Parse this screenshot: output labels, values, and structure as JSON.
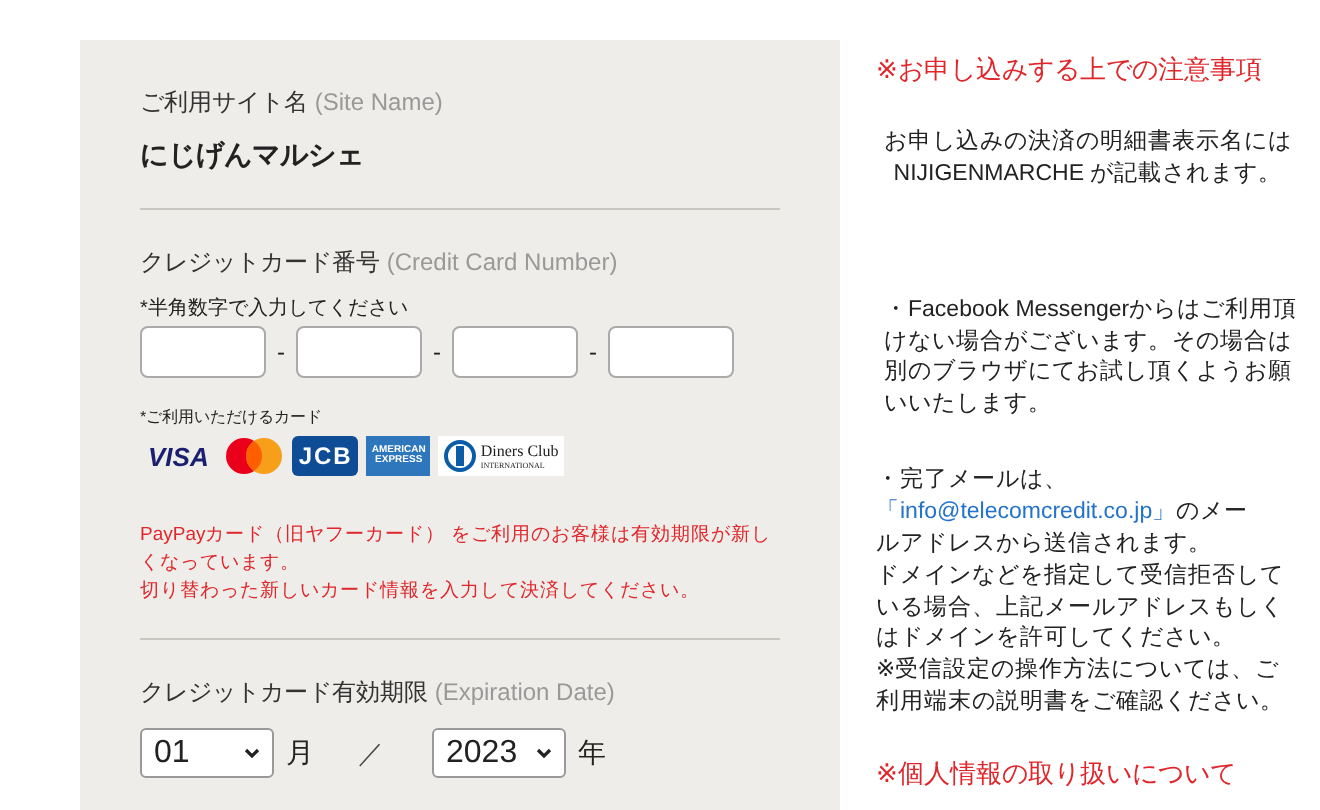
{
  "form": {
    "site_name": {
      "label": "ご利用サイト名",
      "label_en": "(Site Name)",
      "value": "にじげんマルシェ"
    },
    "card_number": {
      "label": "クレジットカード番号",
      "label_en": "(Credit Card Number)",
      "hint": "*半角数字で入力してください",
      "separator": "-"
    },
    "accepted_cards": {
      "label": "*ご利用いただけるカード",
      "cards": [
        {
          "kind": "visa",
          "text": "VISA"
        },
        {
          "kind": "mastercard"
        },
        {
          "kind": "jcb",
          "text": "JCB"
        },
        {
          "kind": "amex",
          "text": "AMERICAN EXPRESS"
        },
        {
          "kind": "diners",
          "text": "Diners Club",
          "subtext": "INTERNATIONAL"
        }
      ]
    },
    "notice": [
      "PayPayカード（旧ヤフーカード） をご利用のお客様は有効期限が新しくなっています。",
      "切り替わった新しいカード情報を入力して決済してください。"
    ],
    "expiration": {
      "label": "クレジットカード有効期限",
      "label_en": "(Expiration Date)",
      "month": "01",
      "month_unit": "月",
      "slash": "／",
      "year": "2023",
      "year_unit": "年"
    }
  },
  "notes": {
    "heading": "※お申し込みする上での注意事項",
    "paragraphs": [
      {
        "kind": "centered",
        "lines": [
          "お申し込みの決済の明細書表示名には",
          "NIJIGENMARCHE が記載されます。"
        ]
      },
      {
        "kind": "text",
        "text": "・Facebook Messengerからはご利用頂けない場合がございます。その場合は別のブラウザにてお試し頂くようお願いいたします。"
      },
      {
        "kind": "link",
        "before": "・完了メールは、",
        "link": "「info@telecomcredit.co.jp」",
        "after": [
          "のメー",
          "ルアドレスから送信されます。",
          "ドメインなどを指定して受信拒否して",
          "いる場合、上記メールアドレスもしく",
          "はドメインを許可してください。",
          "※受信設定の操作方法については、ご",
          "利用端末の説明書をご確認ください。"
        ]
      }
    ],
    "privacy": "※個人情報の取り扱いについて"
  }
}
